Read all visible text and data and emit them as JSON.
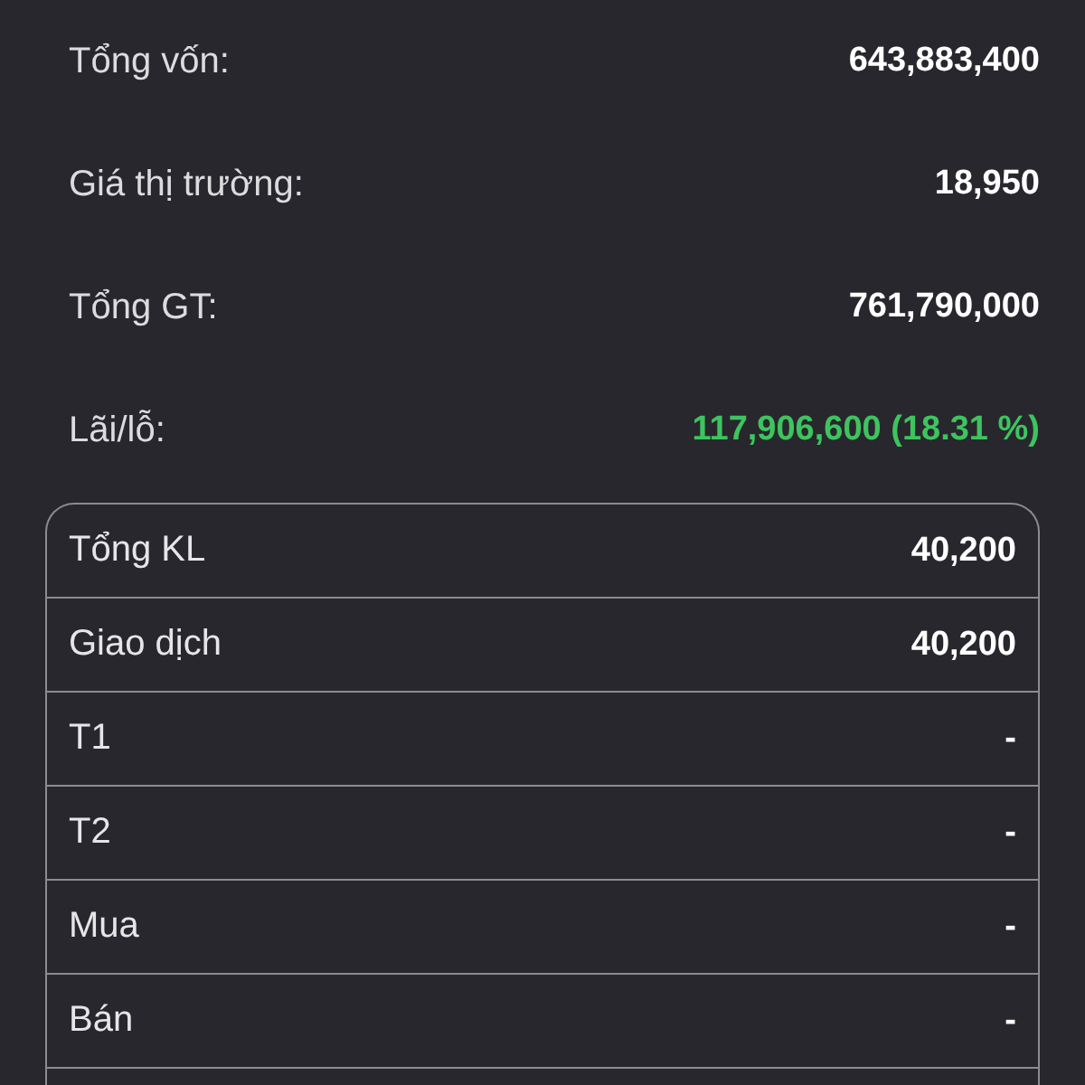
{
  "summary": [
    {
      "label": "Tổng vốn:",
      "value": "643,883,400",
      "color": "#ffffff"
    },
    {
      "label": "Giá thị trường:",
      "value": "18,950",
      "color": "#ffffff"
    },
    {
      "label": "Tổng GT:",
      "value": "761,790,000",
      "color": "#ffffff"
    },
    {
      "label": "Lãi/lỗ:",
      "value": "117,906,600 (18.31 %)",
      "color": "#3ec45f"
    }
  ],
  "details": [
    {
      "label": "Tổng KL",
      "value": "40,200"
    },
    {
      "label": "Giao dịch",
      "value": "40,200"
    },
    {
      "label": "T1",
      "value": "-"
    },
    {
      "label": "T2",
      "value": "-"
    },
    {
      "label": "Mua",
      "value": "-"
    },
    {
      "label": "Bán",
      "value": "-"
    }
  ]
}
